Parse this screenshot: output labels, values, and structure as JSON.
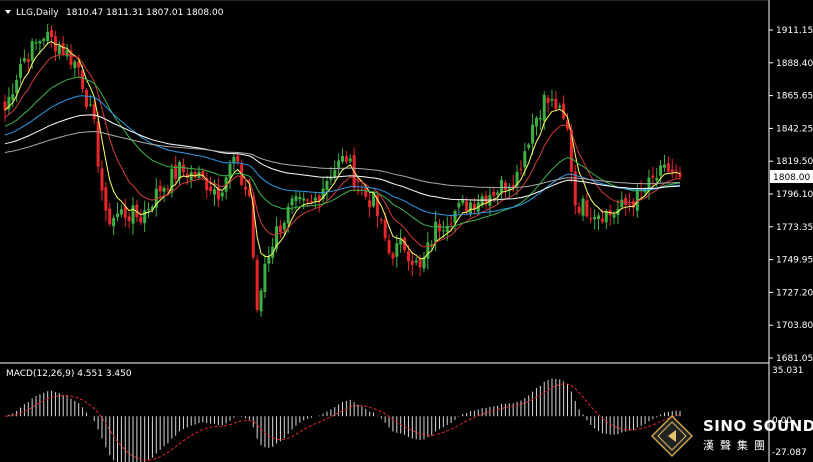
{
  "header": {
    "symbol": "LLG,Daily",
    "ohlc": "1810.47 1811.31 1807.01 1808.00"
  },
  "price_axis": {
    "ticks": [
      "1911.15",
      "1888.40",
      "1865.65",
      "1842.25",
      "1819.50",
      "1796.10",
      "1773.35",
      "1749.95",
      "1727.20",
      "1703.80",
      "1681.05"
    ],
    "current_price": "1808.00"
  },
  "macd": {
    "label": "MACD(12,26,9) 4.551 3.450",
    "top_label": "35.031",
    "zero_label": "0.00",
    "bottom_label": "-27.087"
  },
  "watermark": {
    "brand": "SINO SOUND",
    "chinese": "漢聲集團",
    "logo": "diamond-logo-icon"
  },
  "colors": {
    "background": "#000000",
    "bull": "#3cb043",
    "bear": "#e8262b",
    "axis": "#ffffff"
  },
  "chart_data": [
    {
      "type": "candlestick",
      "title": "LLG,Daily",
      "ylim": [
        1681.05,
        1911.15
      ],
      "price_scale": {
        "top": 1911.15,
        "bottom": 1681.05
      },
      "trend_points": [
        [
          0,
          1855
        ],
        [
          4,
          1888
        ],
        [
          10,
          1908
        ],
        [
          15,
          1898
        ],
        [
          19,
          1885
        ],
        [
          23,
          1842
        ],
        [
          26,
          1778
        ],
        [
          30,
          1783
        ],
        [
          35,
          1780
        ],
        [
          40,
          1800
        ],
        [
          45,
          1813
        ],
        [
          50,
          1808
        ],
        [
          55,
          1798
        ],
        [
          59,
          1820
        ],
        [
          61,
          1805
        ],
        [
          63,
          1795
        ],
        [
          65,
          1710
        ],
        [
          67,
          1748
        ],
        [
          70,
          1770
        ],
        [
          74,
          1788
        ],
        [
          79,
          1788
        ],
        [
          84,
          1812
        ],
        [
          88,
          1822
        ],
        [
          91,
          1800
        ],
        [
          95,
          1790
        ],
        [
          99,
          1755
        ],
        [
          103,
          1760
        ],
        [
          107,
          1742
        ],
        [
          111,
          1772
        ],
        [
          115,
          1782
        ],
        [
          121,
          1792
        ],
        [
          127,
          1800
        ],
        [
          132,
          1810
        ],
        [
          136,
          1845
        ],
        [
          139,
          1862
        ],
        [
          142,
          1858
        ],
        [
          145,
          1840
        ],
        [
          147,
          1790
        ],
        [
          151,
          1785
        ],
        [
          156,
          1782
        ],
        [
          160,
          1788
        ],
        [
          164,
          1796
        ],
        [
          168,
          1808
        ],
        [
          171,
          1813
        ],
        [
          174,
          1808
        ]
      ],
      "moving_averages": [
        {
          "color": "#ffff66",
          "ema": 0.3
        },
        {
          "color": "#d13b3b",
          "ema": 0.15
        },
        {
          "color": "#39b54a",
          "ema": 0.06
        },
        {
          "color": "#2d9be6",
          "ema": 0.035
        },
        {
          "color": "#ffffff",
          "ema": 0.02
        },
        {
          "color": "#aaaaaa",
          "ema": 0.012
        }
      ]
    },
    {
      "type": "bar",
      "title": "MACD(12,26,9) 4.551 3.450",
      "ylim": [
        -27.087,
        35.031
      ],
      "values_latest": {
        "macd": 4.551,
        "signal": 3.45
      }
    }
  ]
}
